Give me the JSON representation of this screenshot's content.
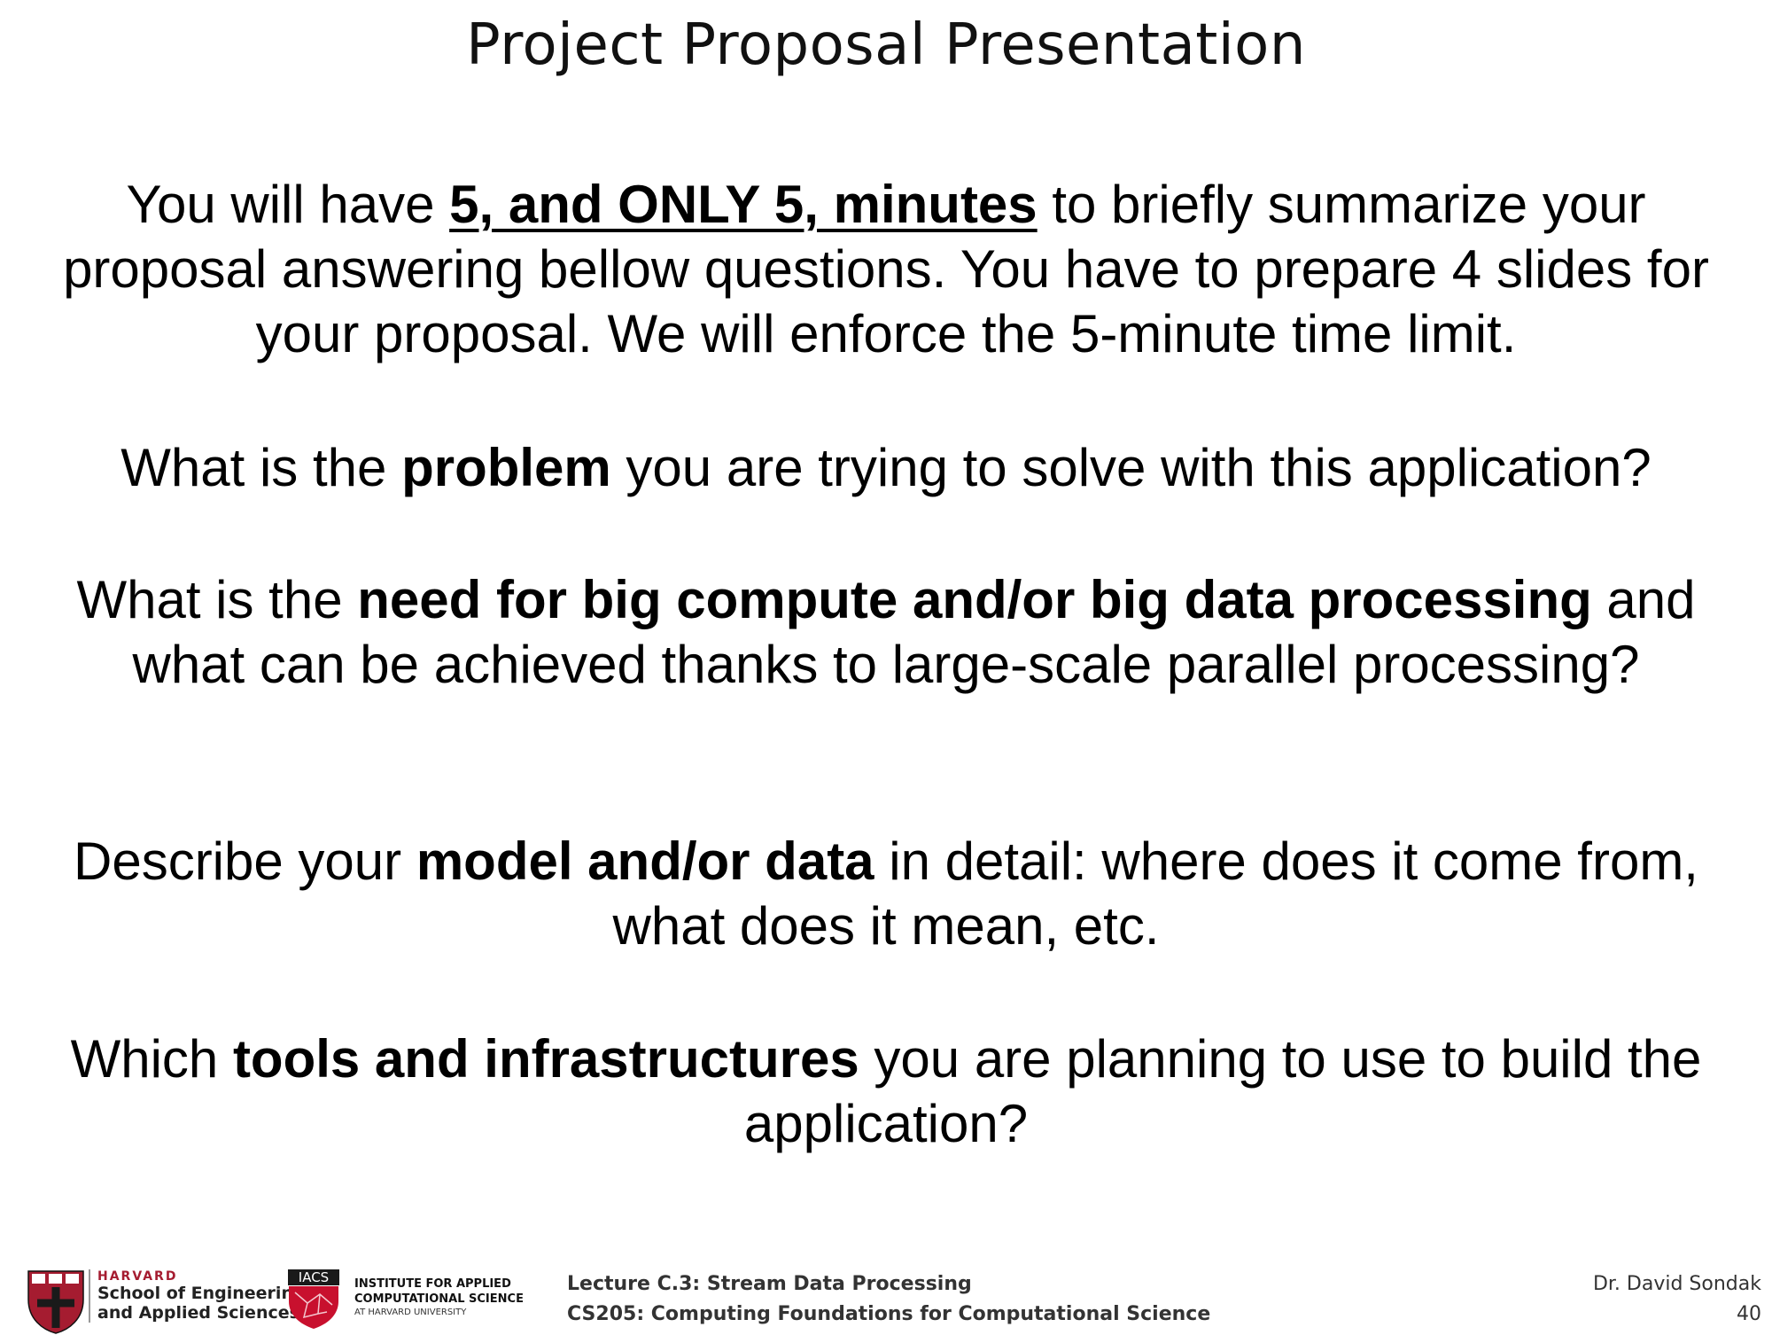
{
  "slide": {
    "title": "Project Proposal Presentation",
    "p1": {
      "pre": "You will have ",
      "emphasis": "5, and ONLY 5, minutes",
      "post": " to briefly summarize your proposal answering bellow questions. You have to prepare 4 slides for your proposal. We will enforce the 5-minute time limit."
    },
    "p2": {
      "pre": "What is the ",
      "bold": "problem",
      "post": " you are trying to solve with this application?"
    },
    "p3": {
      "pre": "What is the ",
      "bold": "need for big compute and/or big data processing",
      "post": " and what can be achieved thanks to large-scale parallel processing?"
    },
    "p4": {
      "pre": "Describe your ",
      "bold": "model and/or data",
      "post": " in detail: where does it come from, what does it mean, etc."
    },
    "p5": {
      "pre": "Which ",
      "bold": "tools and infrastructures",
      "post": " you are planning to use to build the application?"
    }
  },
  "footer": {
    "harvard_word": "HARVARD",
    "harvard_school_line1": "School of Engineering",
    "harvard_school_line2": "and Applied Sciences",
    "iacs_badge": "IACS",
    "iacs_line1": "INSTITUTE FOR APPLIED",
    "iacs_line2": "COMPUTATIONAL SCIENCE",
    "iacs_line3": "AT HARVARD UNIVERSITY",
    "lecture_line1": "Lecture C.3: Stream Data Processing",
    "lecture_line2": "CS205: Computing Foundations for Computational Science",
    "author": "Dr. David Sondak",
    "page_number": "40"
  },
  "colors": {
    "harvard_crimson": "#a51c30",
    "iacs_red": "#c8102e"
  }
}
